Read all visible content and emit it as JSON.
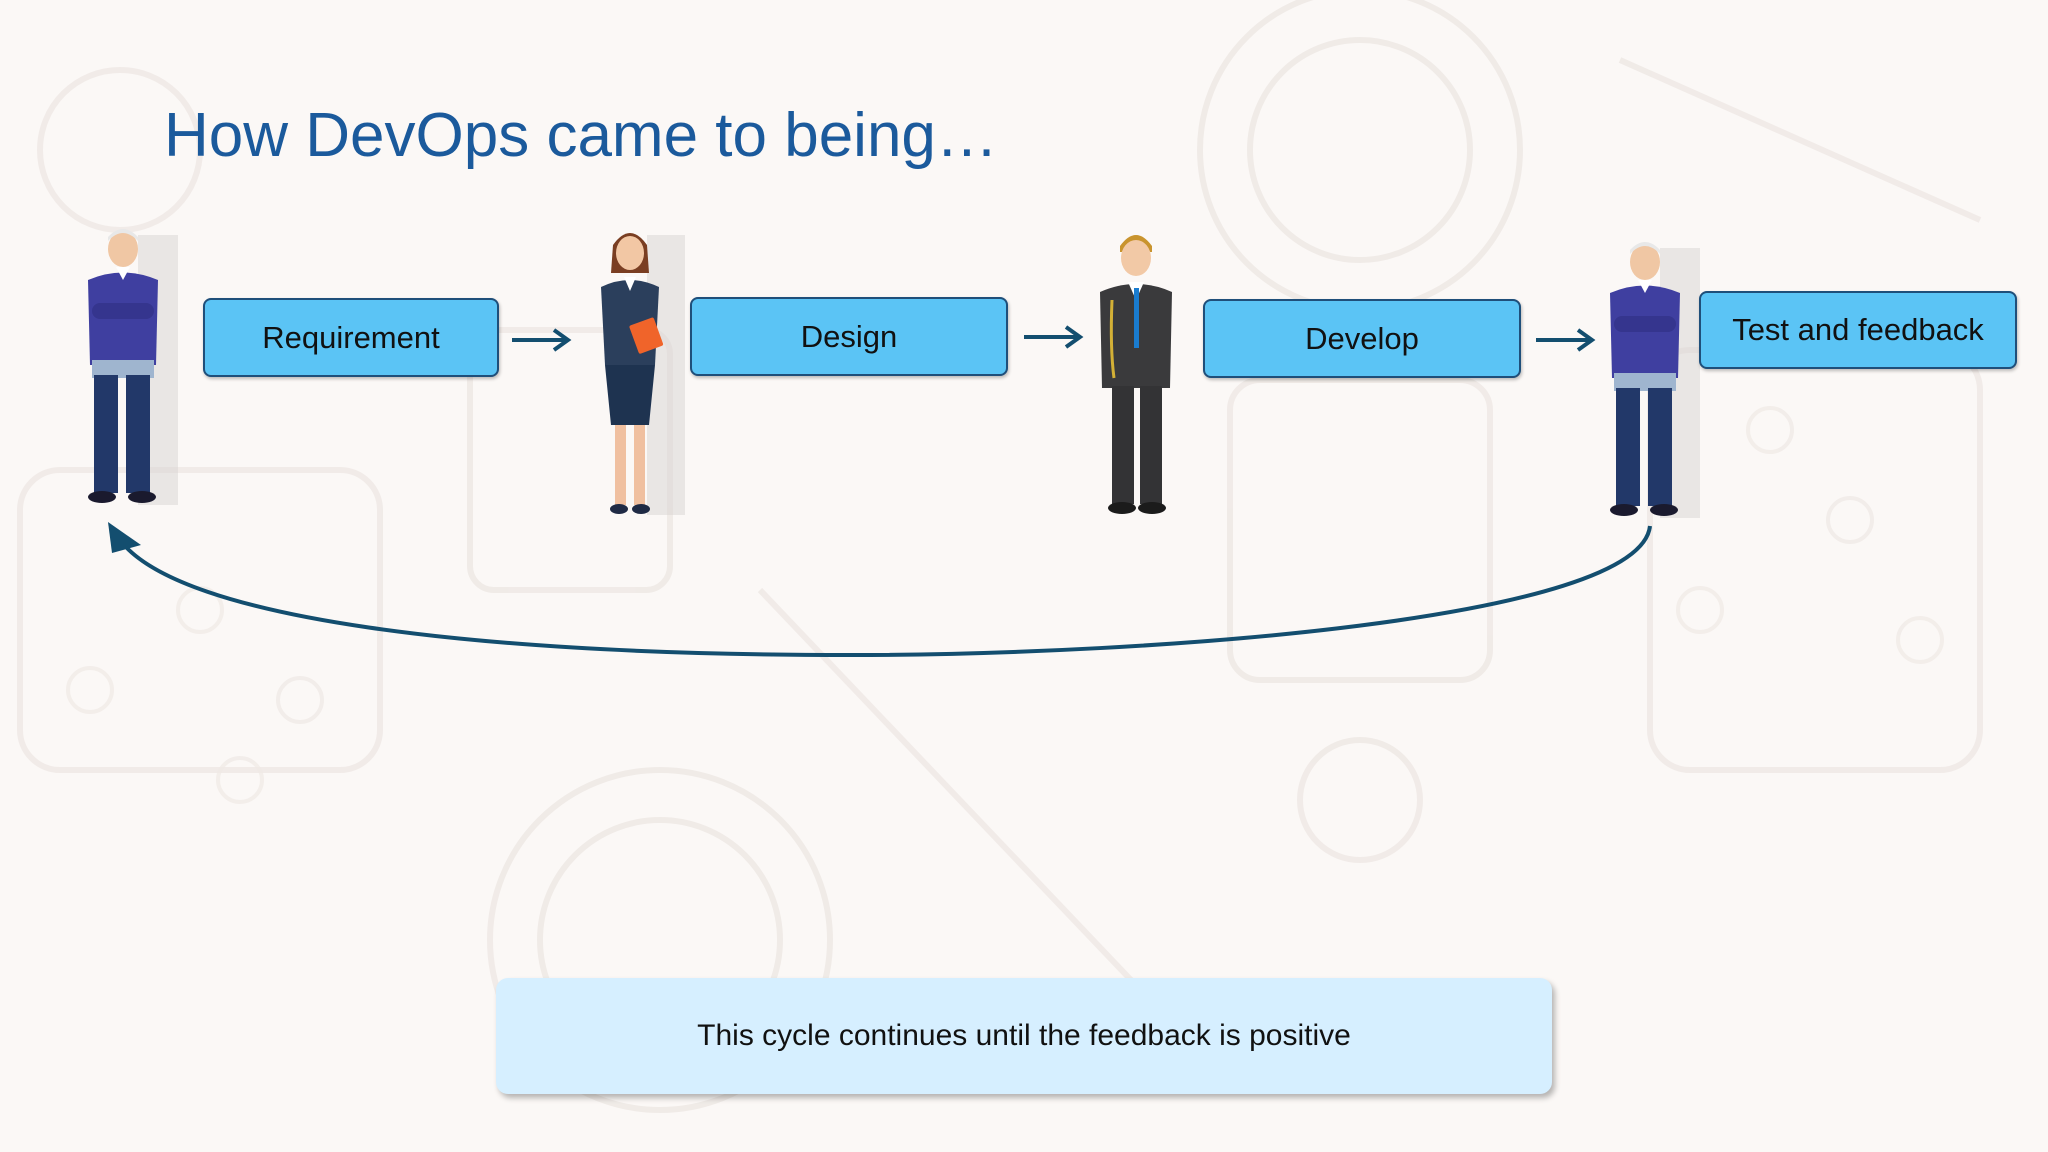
{
  "slide": {
    "title": "How DevOps came to being…",
    "note": "This cycle continues until the feedback is positive"
  },
  "steps": [
    {
      "label": "Requirement"
    },
    {
      "label": "Design"
    },
    {
      "label": "Develop"
    },
    {
      "label": "Test and feedback"
    }
  ],
  "colors": {
    "title": "#1b5a9c",
    "box_fill": "#5bc4f5",
    "box_border": "#1f4f7a",
    "arrow": "#134e6f",
    "note_fill": "#d6efff"
  },
  "icons": [
    "client-person-icon",
    "analyst-person-icon",
    "developer-person-icon",
    "tester-person-icon",
    "right-arrow-icon",
    "feedback-loop-arrow"
  ]
}
